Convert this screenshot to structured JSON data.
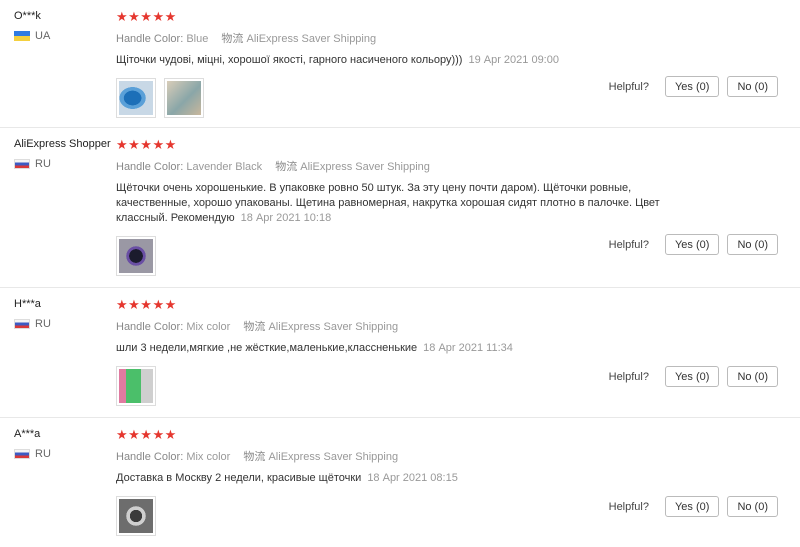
{
  "helpful_label": "Helpful?",
  "reviews": [
    {
      "user": "O***k",
      "country": "UA",
      "stars": "★★★★★",
      "color_key": "Handle Color:",
      "color_val": "Blue",
      "shipping_key": "物流",
      "shipping_val": "AliExpress Saver Shipping",
      "text": "Щіточки чудові, міцні, хорошої якості, гарного насиченого кольору)))",
      "date": "19 Apr 2021 09:00",
      "yes": "Yes (0)",
      "no": "No (0)"
    },
    {
      "user": "AliExpress Shopper",
      "country": "RU",
      "stars": "★★★★★",
      "color_key": "Handle Color:",
      "color_val": "Lavender Black",
      "shipping_key": "物流",
      "shipping_val": "AliExpress Saver Shipping",
      "text": "Щёточки очень хорошенькие. В упаковке ровно 50 штук. За эту цену почти даром). Щёточки ровные, качественные, хорошо упакованы. Щетина равномерная, накрутка хорошая сидят плотно в палочке. Цвет классный. Рекомендую",
      "date": "18 Apr 2021 10:18",
      "yes": "Yes (0)",
      "no": "No (0)"
    },
    {
      "user": "H***a",
      "country": "RU",
      "stars": "★★★★★",
      "color_key": "Handle Color:",
      "color_val": "Mix color",
      "shipping_key": "物流",
      "shipping_val": "AliExpress Saver Shipping",
      "text": "шли 3 недели,мягкие ,не жёсткие,маленькие,классненькие",
      "date": "18 Apr 2021 11:34",
      "yes": "Yes (0)",
      "no": "No (0)"
    },
    {
      "user": "A***a",
      "country": "RU",
      "stars": "★★★★★",
      "color_key": "Handle Color:",
      "color_val": "Mix color",
      "shipping_key": "物流",
      "shipping_val": "AliExpress Saver Shipping",
      "text": "Доставка в Москву 2 недели, красивые щёточки",
      "date": "18 Apr 2021 08:15",
      "yes": "Yes (0)",
      "no": "No (0)"
    }
  ]
}
